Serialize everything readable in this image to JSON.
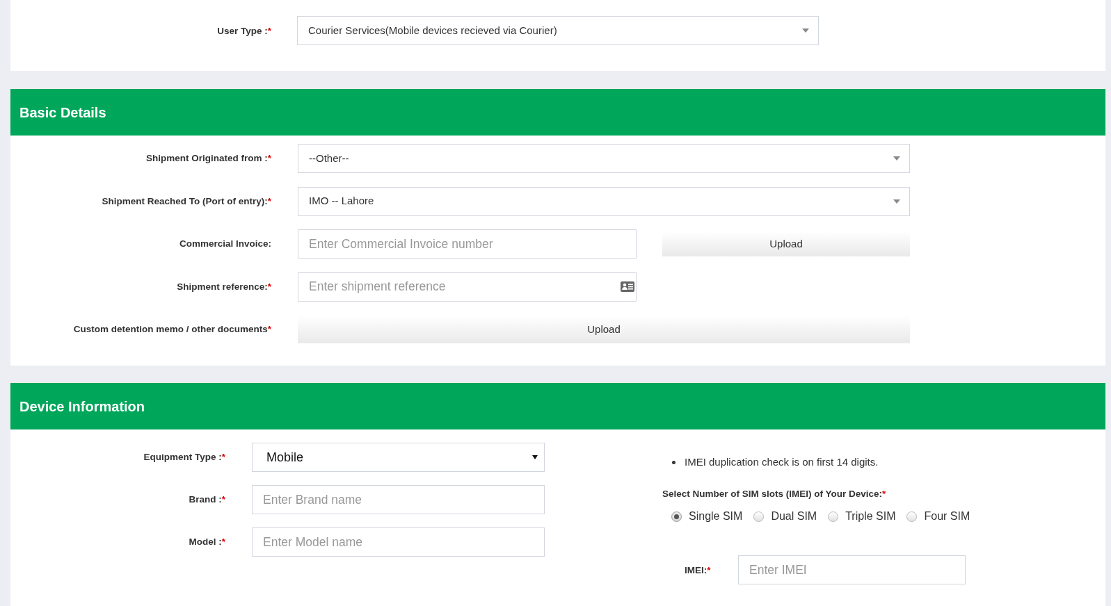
{
  "user_type": {
    "label": "User Type :",
    "required_mark": "*",
    "value": "Courier Services(Mobile devices recieved via Courier)"
  },
  "basic_details": {
    "title": "Basic Details",
    "fields": [
      {
        "kind": "select",
        "label": "Shipment Originated from :",
        "required_mark": "*",
        "value": "--Other--"
      },
      {
        "kind": "select",
        "label": "Shipment Reached To (Port of entry):",
        "required_mark": "*",
        "value": "IMO -- Lahore"
      },
      {
        "kind": "input_with_upload",
        "label": "Commercial Invoice:",
        "placeholder": "Enter Commercial Invoice number",
        "button": "Upload"
      },
      {
        "kind": "input_with_icon",
        "label": "Shipment reference:",
        "required_mark": "*",
        "placeholder": "Enter shipment reference"
      },
      {
        "kind": "upload",
        "label": "Custom detention memo / other documents",
        "required_mark": "*",
        "button": "Upload"
      }
    ]
  },
  "device_information": {
    "title": "Device Information",
    "fields": [
      {
        "kind": "native_select",
        "label": "Equipment Type :",
        "required_mark": "*",
        "value": "Mobile"
      },
      {
        "kind": "input",
        "label": "Brand :",
        "required_mark": "*",
        "placeholder": "Enter Brand name"
      },
      {
        "kind": "input",
        "label": "Model :",
        "required_mark": "*",
        "placeholder": "Enter Model name"
      }
    ],
    "notes": [
      "IMEI duplication check is on first 14 digits."
    ],
    "sim_slots": {
      "label": "Select Number of SIM slots (IMEI) of Your Device:",
      "required_mark": "*",
      "options": [
        {
          "label": "Single SIM",
          "selected": true
        },
        {
          "label": "Dual SIM",
          "selected": false
        },
        {
          "label": "Triple SIM",
          "selected": false
        },
        {
          "label": "Four SIM",
          "selected": false
        }
      ]
    },
    "imei": {
      "label": "IMEI:",
      "required_mark": "*",
      "placeholder": "Enter IMEI"
    }
  }
}
